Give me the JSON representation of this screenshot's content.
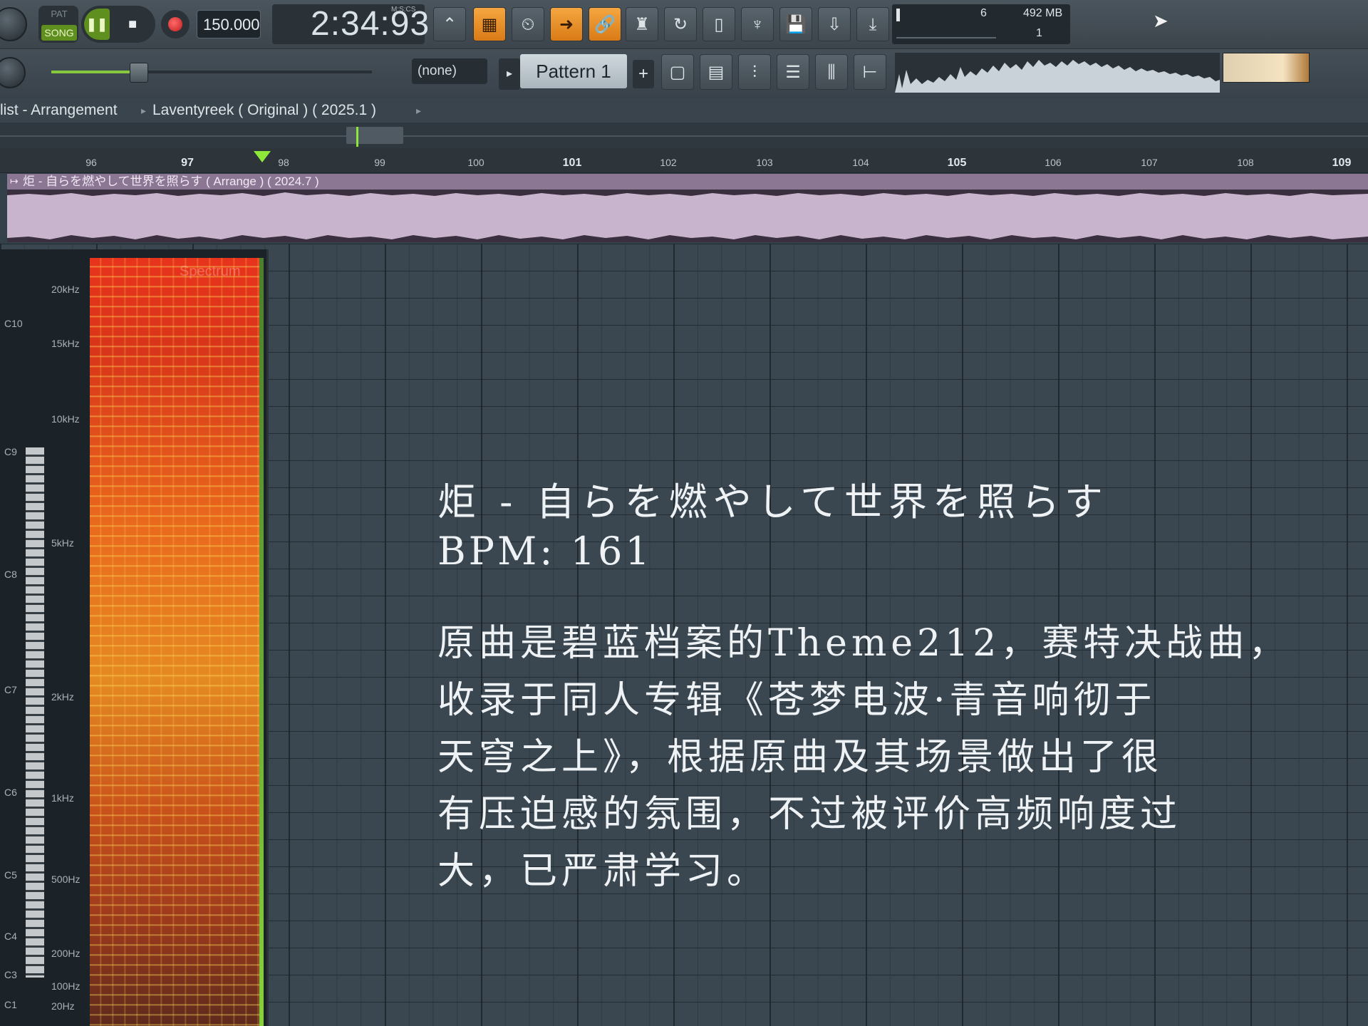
{
  "toolbar": {
    "pat_label": "PAT",
    "song_label": "SONG",
    "pause_icon": "pause-icon",
    "stop_icon": "stop-icon",
    "tempo": "150.000",
    "time_display": "2:34:93",
    "time_format": "M:S:CS",
    "cpu": "6",
    "memory": "492 MB",
    "polyphony": "1",
    "snap_value": "(none)",
    "pattern_name": "Pattern 1",
    "pattern_add": "+",
    "tools_row1": [
      "metronome-icon",
      "typing-keyboard-icon",
      "wait-record-icon",
      "step-edit-arrow-icon",
      "link-chain-icon",
      "blend-notes-icon",
      "loop-record-icon",
      "new-file-icon",
      "plugin-picker-icon",
      "save-icon",
      "save-as-icon",
      "export-icon"
    ],
    "tools_row2": [
      "playlist-icon",
      "piano-roll-icon",
      "step-sequencer-icon",
      "channel-rack-icon",
      "mixer-icon",
      "browser-icon"
    ],
    "colors": {
      "accent_orange": "#f29b32",
      "song_green": "#5f8f1e",
      "record_red": "#d62a2a"
    }
  },
  "breadcrumb": {
    "part1": "list - Arrangement",
    "part2": "Laventyreek ( Original ) ( 2025.1 )"
  },
  "ruler": {
    "labels": [
      "96",
      "97",
      "98",
      "99",
      "100",
      "101",
      "102",
      "103",
      "104",
      "105",
      "106",
      "107",
      "108",
      "109"
    ],
    "major": [
      "97",
      "101",
      "105",
      "109"
    ]
  },
  "clip": {
    "title": "炬 - 自らを燃やして世界を照らす ( Arrange ) ( 2024.7 )",
    "color": "#c8b4cc"
  },
  "spectrum": {
    "title": "Spectrum",
    "freq_labels": [
      "20kHz",
      "15kHz",
      "10kHz",
      "5kHz",
      "2kHz",
      "1kHz",
      "500Hz",
      "200Hz",
      "100Hz",
      "20Hz"
    ],
    "note_labels": [
      "C10",
      "C9",
      "C8",
      "C7",
      "C6",
      "C5",
      "C4",
      "C3",
      "C1"
    ]
  },
  "overlay": {
    "title": "炬 - 自らを燃やして世界を照らす",
    "bpm": "BPM: 161",
    "description_lines": [
      "原曲是碧蓝档案的Theme212，赛特决战曲，",
      "收录于同人专辑《苍梦电波·青音响彻于",
      "天穹之上》，根据原曲及其场景做出了很",
      "有压迫感的氛围，不过被评价高频响度过",
      "大，已严肃学习。"
    ]
  }
}
